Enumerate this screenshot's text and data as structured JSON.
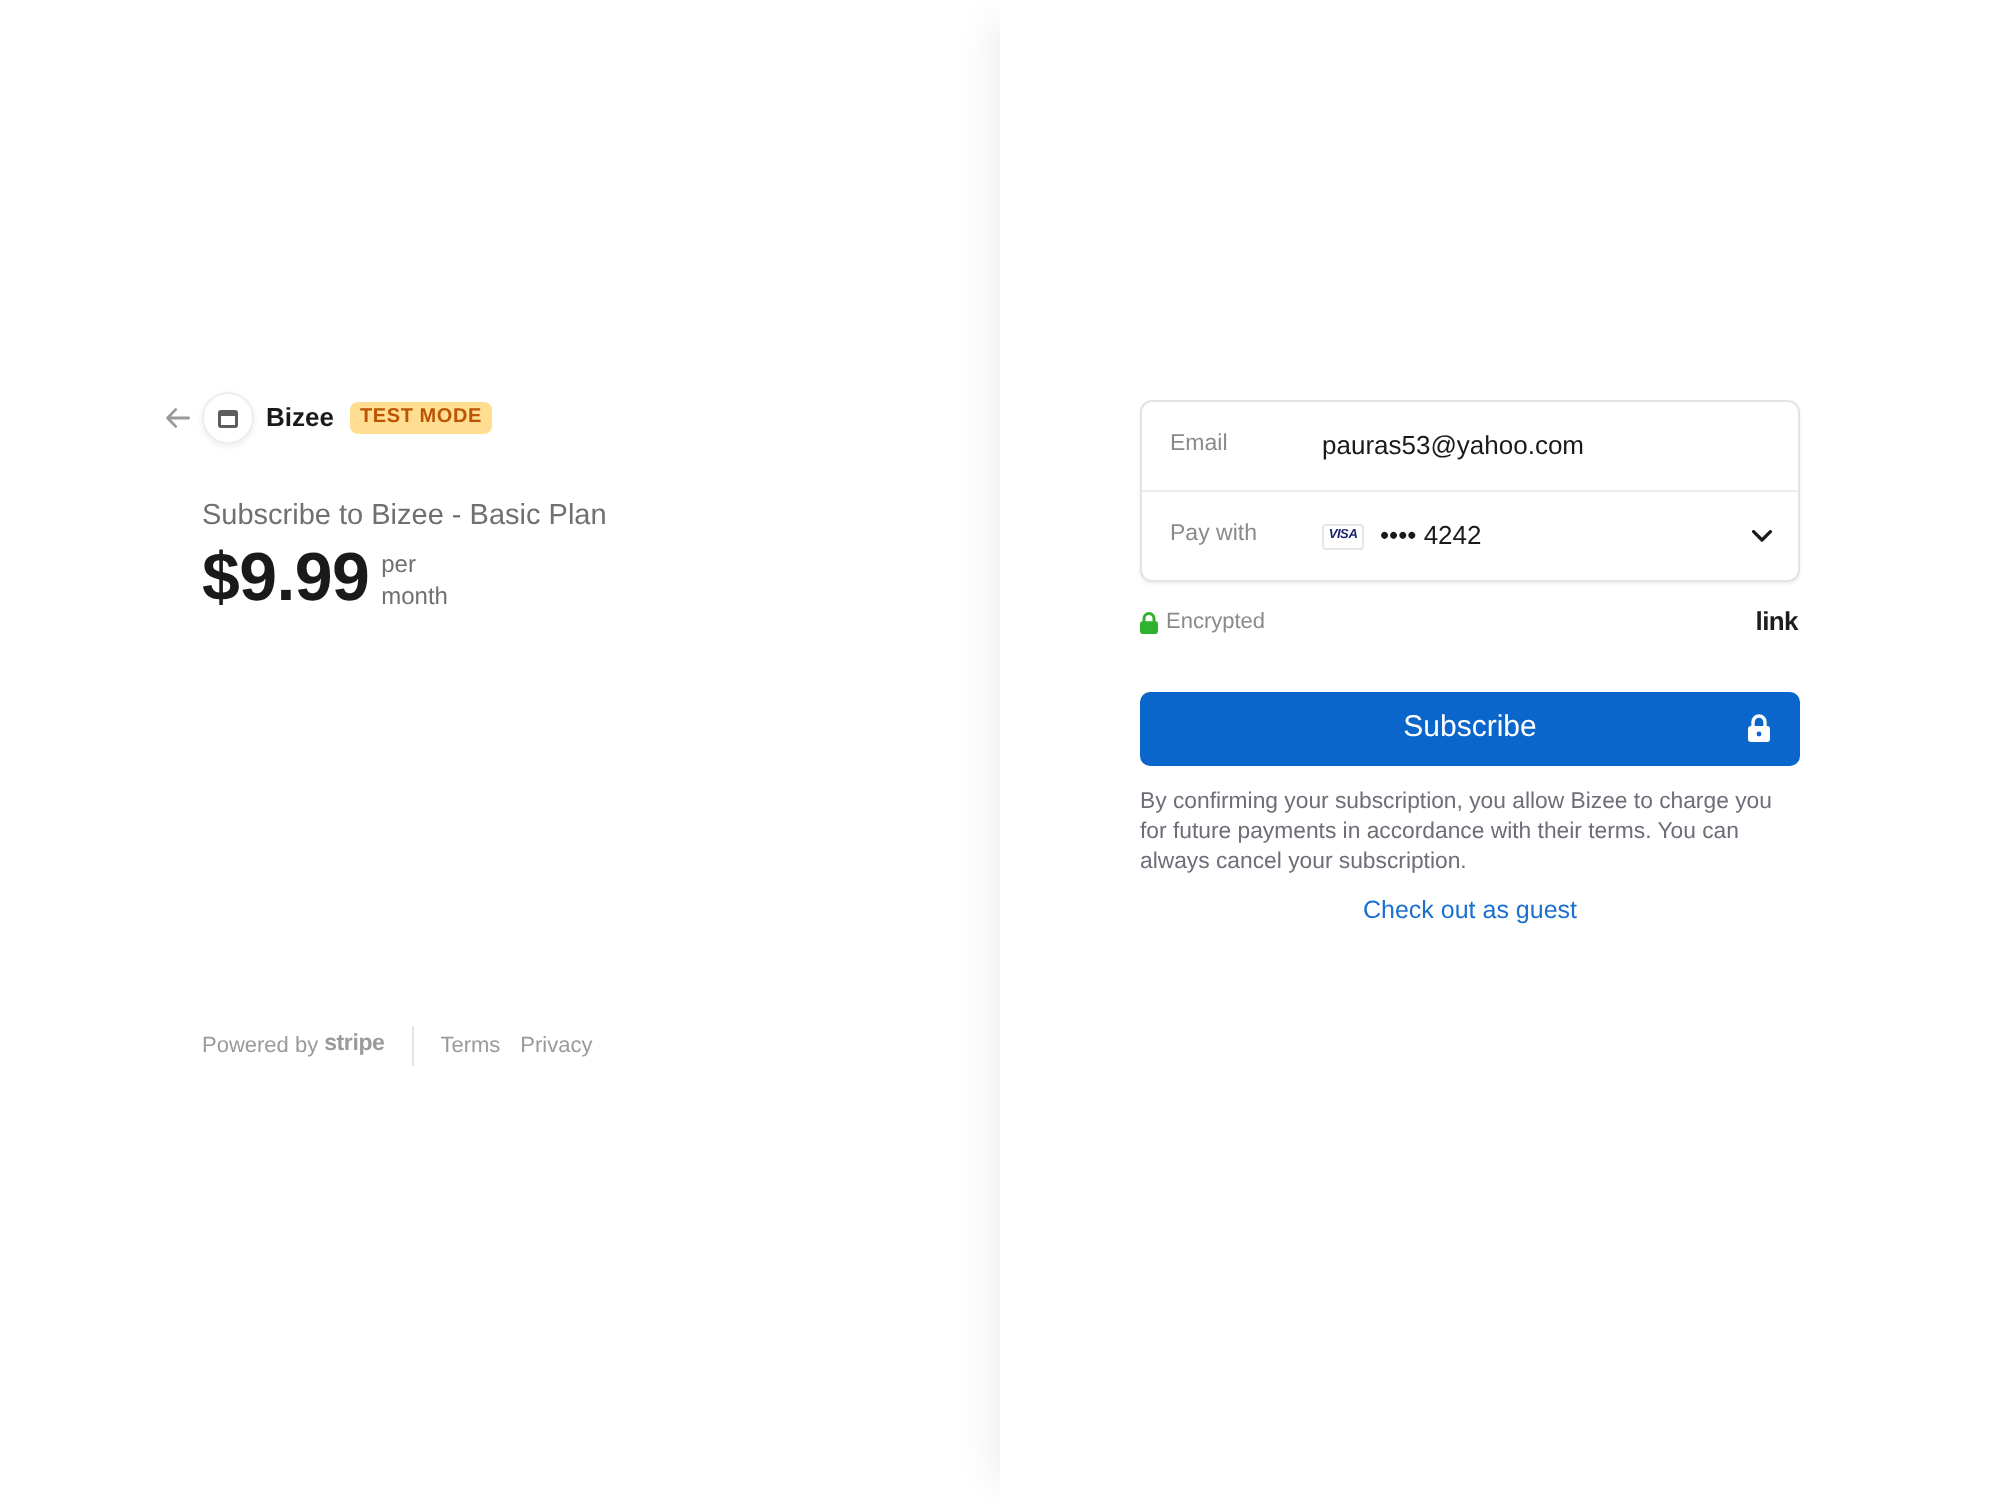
{
  "header": {
    "business_name": "Bizee",
    "badge": "TEST MODE"
  },
  "product": {
    "title": "Subscribe to Bizee - Basic Plan",
    "price": "$9.99",
    "interval": "per month"
  },
  "footer": {
    "powered_by": "Powered by",
    "brand": "stripe",
    "links": [
      "Terms",
      "Privacy"
    ]
  },
  "form": {
    "fields": [
      {
        "kind": "email",
        "label": "Email",
        "value": "pauras53@yahoo.com"
      },
      {
        "kind": "card",
        "label": "Pay with",
        "card_brand": "VISA",
        "value": "•••• 4242"
      }
    ],
    "security_note": "Encrypted",
    "wallet_logo": "link",
    "submit": "Subscribe",
    "terms": "By confirming your subscription, you allow Bizee to charge you for future payments in accordance with their terms. You can always cancel your subscription.",
    "guest_link": "Check out as guest"
  }
}
